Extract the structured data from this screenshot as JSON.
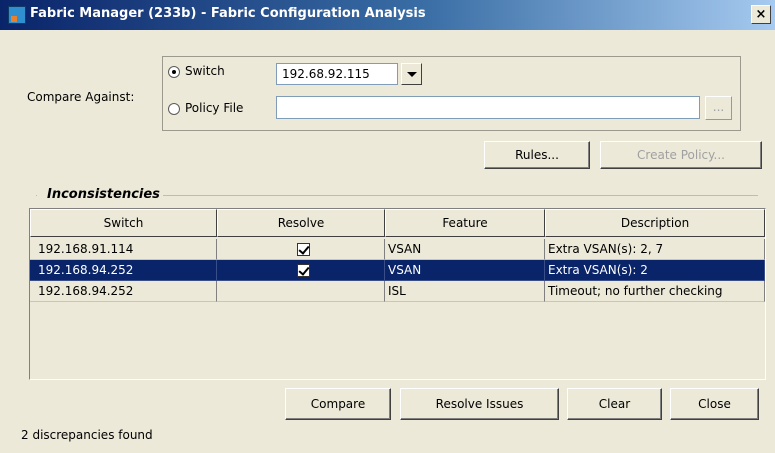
{
  "window": {
    "title": "Fabric Manager (233b) - Fabric Configuration Analysis",
    "close_glyph": "×"
  },
  "compare": {
    "label": "Compare Against:",
    "options": [
      "Switch",
      "Policy File"
    ],
    "selected": "Switch",
    "switch_value": "192.68.92.115",
    "policy_file_value": "",
    "browse_label": "..."
  },
  "actions": {
    "rules": "Rules...",
    "create_policy": "Create Policy..."
  },
  "inconsistencies": {
    "title": "Inconsistencies",
    "columns": [
      "Switch",
      "Resolve",
      "Feature",
      "Description"
    ],
    "rows": [
      {
        "switch": "192.168.91.114",
        "resolve": true,
        "feature": "VSAN",
        "description": "Extra VSAN(s): 2, 7",
        "selected": false
      },
      {
        "switch": "192.168.94.252",
        "resolve": true,
        "feature": "VSAN",
        "description": "Extra VSAN(s): 2",
        "selected": true
      },
      {
        "switch": "192.168.94.252",
        "resolve": false,
        "feature": "ISL",
        "description": "Timeout; no further checking",
        "selected": false
      }
    ]
  },
  "buttons": {
    "compare": "Compare",
    "resolve": "Resolve Issues",
    "clear": "Clear",
    "close": "Close"
  },
  "status": "2 discrepancies found"
}
